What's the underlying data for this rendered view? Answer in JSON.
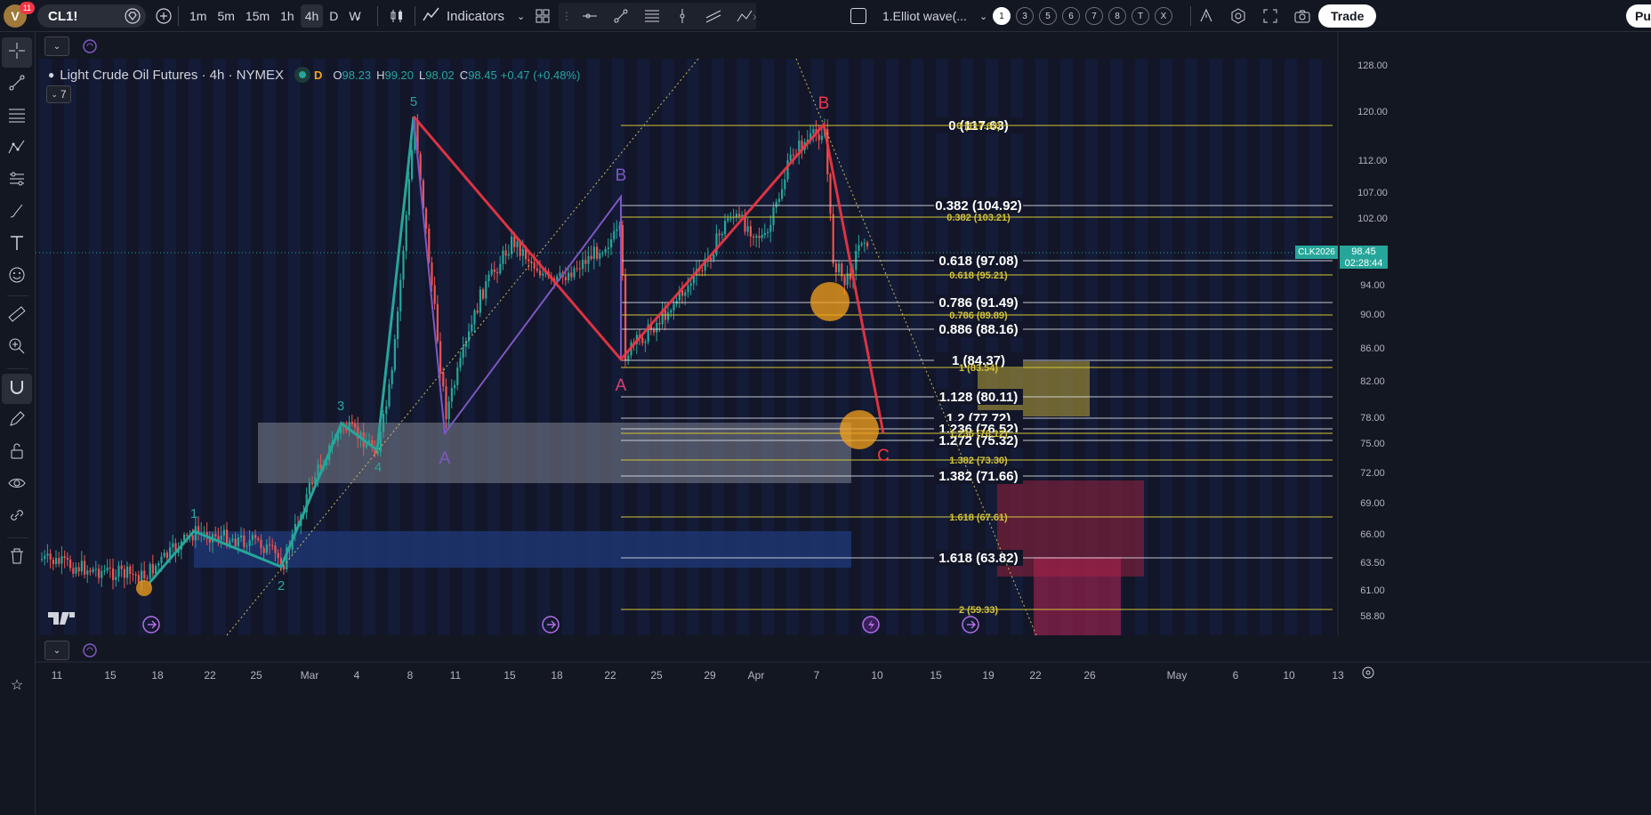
{
  "topbar": {
    "avatar_letter": "V",
    "notif_count": "11",
    "symbol": "CL1!",
    "timeframes": [
      "1m",
      "5m",
      "15m",
      "1h",
      "4h",
      "D",
      "W"
    ],
    "active_timeframe": "4h",
    "indicators_label": "Indicators",
    "layout_name": "1.Elliot wave(...",
    "wave_degrees": [
      "1",
      "3",
      "5",
      "6",
      "7",
      "8",
      "T",
      "X"
    ],
    "trade_label": "Trade",
    "publish_label": "Pu"
  },
  "legend": {
    "title": "Light Crude Oil Futures · 4h · NYMEX",
    "d_badge": "D",
    "o_label": "O",
    "o_value": "98.23",
    "h_label": "H",
    "h_value": "99.20",
    "l_label": "L",
    "l_value": "98.02",
    "c_label": "C",
    "c_value": "98.45",
    "change": "+0.47 (+0.48%)",
    "indicator_count": "7"
  },
  "price_axis": {
    "ticks": [
      "128.00",
      "120.00",
      "112.00",
      "107.00",
      "102.00",
      "94.00",
      "90.00",
      "86.00",
      "82.00",
      "78.00",
      "75.00",
      "72.00",
      "69.00",
      "66.00",
      "63.50",
      "61.00",
      "58.80"
    ],
    "current_symbol": "CLK2026",
    "current_price": "98.45",
    "countdown": "02:28:44"
  },
  "time_axis": {
    "ticks": [
      "11",
      "15",
      "18",
      "22",
      "25",
      "Mar",
      "4",
      "8",
      "11",
      "15",
      "18",
      "22",
      "25",
      "29",
      "Apr",
      "7",
      "10",
      "15",
      "19",
      "22",
      "26",
      "May",
      "6",
      "10",
      "13"
    ]
  },
  "waves": {
    "impulse": [
      "1",
      "2",
      "3",
      "4",
      "5"
    ],
    "corr_purple": [
      "A",
      "B",
      "A"
    ],
    "corr_red": [
      "B",
      "C"
    ]
  },
  "fib_white": [
    "0 (117.63)",
    "0.382 (104.92)",
    "0.618 (97.08)",
    "0.786 (91.49)",
    "0.886 (88.16)",
    "1 (84.37)",
    "1.128 (80.11)",
    "1.2 (77.72)",
    "1.236 (76.52)",
    "1.272 (75.32)",
    "1.382 (71.66)",
    "1.618 (63.82)"
  ],
  "fib_yellow": [
    "0 (117.63)",
    "0.382 (103.21)",
    "0.618 (95.21)",
    "0.786 (89.89)",
    "1 (83.54)",
    "1.236 (76.12)",
    "1.382 (73.30)",
    "1.618 (67.61)",
    "2 (59.33)"
  ],
  "colors": {
    "impulse": "#26a69a",
    "red_wave": "#f23645",
    "purple_wave": "#7e57c2",
    "fib_yellow": "#d4c43a",
    "up_candle": "#26a69a",
    "down_candle": "#ef5350"
  }
}
